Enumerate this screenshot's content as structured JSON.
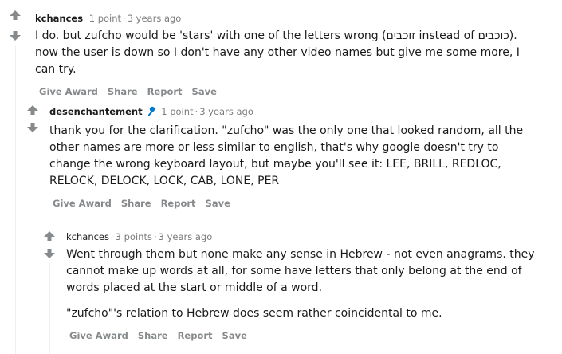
{
  "comments": [
    {
      "author": "kchances",
      "points": "1 point",
      "age": "3 years ago",
      "paragraphs": [
        "I do. but zufcho would be 'stars' with one of the letters wrong (זוכבים instead of כוכבים). now the user is down so I don't have any other video names but give me some more, I can try."
      ],
      "actions": [
        "Give Award",
        "Share",
        "Report",
        "Save"
      ]
    },
    {
      "author": "desenchantement",
      "points": "1 point",
      "age": "3 years ago",
      "paragraphs": [
        "thank you for the clarification. \"zufcho\" was the only one that looked random, all the other names are more or less similar to english, that's why google doesn't try to change the wrong keyboard layout, but maybe you'll see it: LEE, BRILL, REDLOC, RELOCK, DELOCK, LOCK, CAB, LONE, PER"
      ],
      "actions": [
        "Give Award",
        "Share",
        "Report",
        "Save"
      ]
    },
    {
      "author": "kchances",
      "points": "3 points",
      "age": "3 years ago",
      "paragraphs": [
        "Went through them but none make any sense in Hebrew - not even anagrams. they cannot make up words at all, for some have letters that only belong at the end of words placed at the start or middle of a word.",
        "\"zufcho\"'s relation to Hebrew does seem rather coincidental to me."
      ],
      "actions": [
        "Give Award",
        "Share",
        "Report",
        "Save"
      ]
    }
  ],
  "colors": {
    "vote_arrow": "#878a8c",
    "thread_line": "#edeff1",
    "action_text": "#878a8c",
    "mod_icon": "#0079d3"
  },
  "icons": {
    "upvote": "upvote-arrow-icon",
    "downvote": "downvote-arrow-icon",
    "mod": "microphone-icon"
  }
}
